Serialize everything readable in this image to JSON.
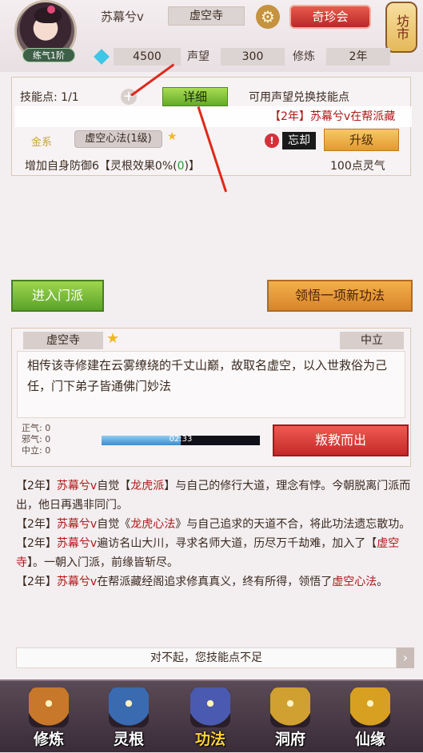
{
  "header": {
    "player_name": "苏幕兮v",
    "sect": "虚空寺",
    "rank": "练气1阶",
    "treasure_button": "奇珍会",
    "shop_label": "坊市",
    "spirit_stones": "4500",
    "reputation_label": "声望",
    "reputation_value": "300",
    "cultivation_label": "修炼",
    "cultivation_value": "2年"
  },
  "skill": {
    "points_text": "技能点: 1/1",
    "detail_button": "详细",
    "exchange_hint": "可用声望兑换技能点",
    "marquee": "【2年】苏幕兮v在帮派藏",
    "element": "金系",
    "skill_name": "虚空心法(1级)",
    "warn_icon": "!",
    "forget_button": "忘却",
    "upgrade_button": "升级",
    "effect_prefix": "增加自身防御6【灵根效果0%(",
    "effect_green": "0",
    "effect_suffix": ")】",
    "cost": "100点灵气"
  },
  "actions": {
    "join_button": "进入门派",
    "learn_button": "领悟一项新功法"
  },
  "sect_panel": {
    "name": "虚空寺",
    "alignment_tag": "中立",
    "description": "相传该寺修建在云雾缭绕的千丈山巅，故取名虚空，以入世救俗为己任，门下弟子皆通佛门妙法",
    "righteous": "正气: 0",
    "evil": "邪气: 0",
    "neutral": "中立: 0",
    "progress_text": "02:33",
    "progress_fraction": 0.5,
    "betray_button": "叛教而出"
  },
  "log": [
    {
      "y": "【2年】",
      "a": "苏幕兮v",
      "b": "自觉【",
      "c": "龙虎派",
      "d": "】与自己的修行大道，理念有悖。今朝脱离门派而出，他日再遇非同门。"
    },
    {
      "y": "【2年】",
      "a": "苏幕兮v",
      "b": "自觉《",
      "c": "龙虎心法",
      "d": "》与自己追求的天道不合，将此功法遗忘散功。"
    },
    {
      "y": "【2年】",
      "a": "苏幕兮v",
      "b": "遍访名山大川，寻求名师大道，历尽万千劫难，加入了【",
      "c": "虚空寺",
      "d": "】。一朝入门派，前缘皆斩尽。"
    },
    {
      "y": "【2年】",
      "a": "苏幕兮v",
      "b": "在帮派藏经阁追求修真真义，终有所得，领悟了",
      "c": "虚空心法",
      "d": "。"
    }
  ],
  "toast": "对不起，您技能点不足",
  "nav": [
    {
      "label": "修炼",
      "icon": "monk-icon",
      "color": "#c8782a"
    },
    {
      "label": "灵根",
      "icon": "sword-icon",
      "color": "#3a6ab0"
    },
    {
      "label": "功法",
      "icon": "book-icon",
      "color": "#4a5ab0"
    },
    {
      "label": "洞府",
      "icon": "pagoda-icon",
      "color": "#d0a030"
    },
    {
      "label": "仙缘",
      "icon": "gourd-icon",
      "color": "#d8a020"
    }
  ],
  "colors": {
    "accent_red": "#b01818",
    "green_button": "#63a928",
    "orange_button": "#d8842a",
    "red_button": "#c42a2a"
  }
}
